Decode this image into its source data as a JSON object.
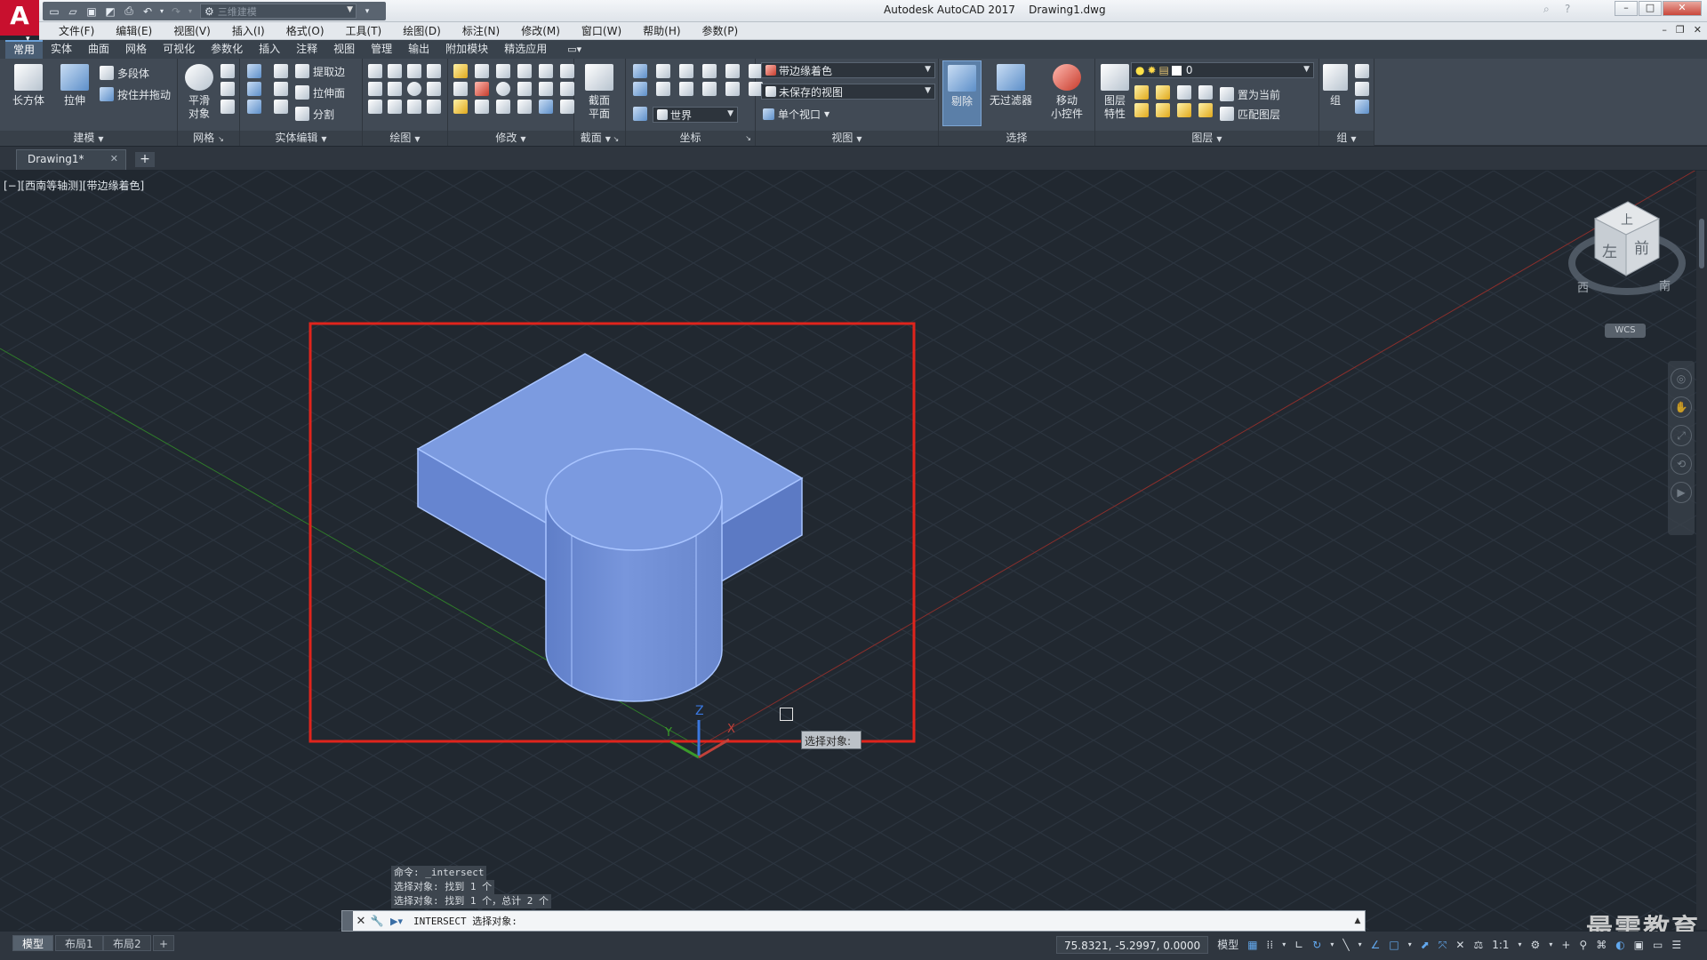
{
  "app": {
    "logo": "A",
    "title": "Autodesk AutoCAD 2017    Drawing1.dwg",
    "workspace": "三维建模"
  },
  "menubar": [
    "文件(F)",
    "编辑(E)",
    "视图(V)",
    "插入(I)",
    "格式(O)",
    "工具(T)",
    "绘图(D)",
    "标注(N)",
    "修改(M)",
    "窗口(W)",
    "帮助(H)",
    "参数(P)"
  ],
  "ribbon": {
    "tabs": [
      "常用",
      "实体",
      "曲面",
      "网格",
      "可视化",
      "参数化",
      "插入",
      "注释",
      "视图",
      "管理",
      "输出",
      "附加模块",
      "精选应用"
    ],
    "active_tab": "常用",
    "modeling": {
      "title": "建模",
      "box": "长方体",
      "extrude": "拉伸",
      "polysolid": "多段体",
      "presspull": "按住并拖动"
    },
    "mesh": {
      "title": "网格",
      "smooth_line1": "平滑",
      "smooth_line2": "对象"
    },
    "solid_edit": {
      "title": "实体编辑",
      "extract_edges": "提取边",
      "extrude_faces": "拉伸面",
      "separate": "分割"
    },
    "draw": {
      "title": "绘图"
    },
    "modify": {
      "title": "修改"
    },
    "section": {
      "title": "截面",
      "btn_line1": "截面",
      "btn_line2": "平面"
    },
    "coordinates": {
      "title": "坐标",
      "world": "世界"
    },
    "view": {
      "title": "视图",
      "visual_style": "带边缘着色",
      "saved_view": "未保存的视图",
      "viewports": "单个视口"
    },
    "selection": {
      "title": "选择",
      "cull": "剔除",
      "no_filter": "无过滤器",
      "gizmo_line1": "移动",
      "gizmo_line2": "小控件"
    },
    "layers": {
      "title": "图层",
      "props_line1": "图层",
      "props_line2": "特性",
      "current_layer": "0",
      "set_current": "置为当前",
      "match_layer": "匹配图层"
    },
    "groups": {
      "title": "组",
      "group": "组"
    }
  },
  "file_tabs": {
    "active": "Drawing1*"
  },
  "viewport": {
    "label": "[−][西南等轴测][带边缘着色]",
    "tooltip": "选择对象:",
    "viewcube": {
      "top": "上",
      "left": "左",
      "front": "前",
      "west": "西",
      "south": "南"
    },
    "wcs": "WCS",
    "ucs": {
      "x": "X",
      "y": "Y",
      "z": "Z"
    }
  },
  "command": {
    "history": [
      "命令: _intersect",
      "选择对象: 找到 1 个",
      "选择对象: 找到 1 个，总计 2 个"
    ],
    "prompt": "INTERSECT 选择对象:"
  },
  "layout_tabs": [
    "模型",
    "布局1",
    "布局2"
  ],
  "status": {
    "coords": "75.8321, -5.2997, 0.0000",
    "model": "模型",
    "scale": "1:1"
  },
  "watermark": "最需教育",
  "colors": {
    "highlight_rect": "#e0241c",
    "solid_fill": "#6f8fd6",
    "solid_edge": "#a8c4ff",
    "x_axis": "#c0413a",
    "y_axis": "#3a9a2a"
  }
}
